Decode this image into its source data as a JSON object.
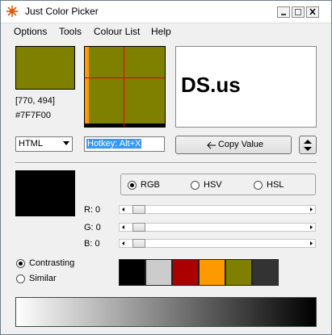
{
  "window": {
    "title": "Just Color Picker"
  },
  "menu": [
    "Options",
    "Tools",
    "Colour List",
    "Help"
  ],
  "picker": {
    "color": "#7f7f00",
    "coords": "[770, 494]",
    "hex": "#7F7F00",
    "preview_text": "DS.us",
    "format": "HTML",
    "hotkey": "Hotkey: Alt+X",
    "copy_label": "Copy Value"
  },
  "color_model": {
    "options": [
      "RGB",
      "HSV",
      "HSL"
    ],
    "selected": "RGB"
  },
  "sliders": [
    {
      "label": "R: 0",
      "value": 0
    },
    {
      "label": "G: 0",
      "value": 0
    },
    {
      "label": "B: 0",
      "value": 0
    }
  ],
  "scheme": {
    "options": [
      "Contrasting",
      "Similar"
    ],
    "selected": "Contrasting"
  },
  "palette": [
    "#000000",
    "#cccccc",
    "#aa0000",
    "#ff9900",
    "#7f7f00",
    "#333333"
  ],
  "colors": {
    "gradient_start": "#ffffff",
    "gradient_end": "#000000",
    "highlight": "#3399ff"
  }
}
